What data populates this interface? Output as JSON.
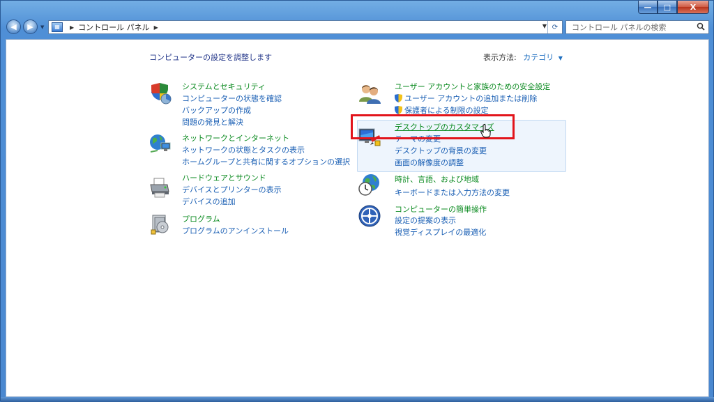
{
  "window": {
    "min_label": "—",
    "max_label": "□",
    "close_label": "X"
  },
  "nav": {
    "back_label": "◀",
    "forward_label": "▶",
    "breadcrumb": "コントロール パネル",
    "search_placeholder": "コントロール パネルの検索"
  },
  "page": {
    "heading": "コンピューターの設定を調整します",
    "view_by_label": "表示方法:",
    "view_by_value": "カテゴリ"
  },
  "left_categories": [
    {
      "title": "システムとセキュリティ",
      "links": [
        "コンピューターの状態を確認",
        "バックアップの作成",
        "問題の発見と解決"
      ]
    },
    {
      "title": "ネットワークとインターネット",
      "links": [
        "ネットワークの状態とタスクの表示",
        "ホームグループと共有に関するオプションの選択"
      ]
    },
    {
      "title": "ハードウェアとサウンド",
      "links": [
        "デバイスとプリンターの表示",
        "デバイスの追加"
      ]
    },
    {
      "title": "プログラム",
      "links": [
        "プログラムのアンインストール"
      ]
    }
  ],
  "right_categories": [
    {
      "title": "ユーザー アカウントと家族のための安全設定",
      "links": [
        "ユーザー アカウントの追加または削除",
        "保護者による制限の設定"
      ]
    },
    {
      "title": "デスクトップのカスタマイズ",
      "links": [
        "テーマの変更",
        "デスクトップの背景の変更",
        "画面の解像度の調整"
      ]
    },
    {
      "title": "時計、言語、および地域",
      "links": [
        "キーボードまたは入力方法の変更"
      ]
    },
    {
      "title": "コンピューターの簡単操作",
      "links": [
        "設定の提案の表示",
        "視覚ディスプレイの最適化"
      ]
    }
  ],
  "colors": {
    "category_title": "#0a8a1f",
    "link": "#1a5fb4",
    "heading": "#1e3287",
    "highlight_outline": "#e2141b"
  }
}
